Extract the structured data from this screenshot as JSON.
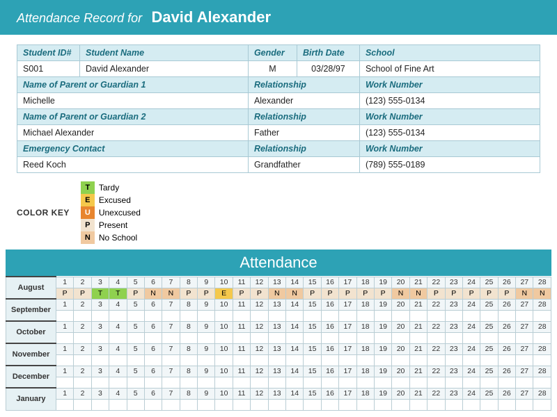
{
  "header": {
    "prefix": "Attendance Record for",
    "student_name": "David Alexander"
  },
  "info": {
    "student_id_h": "Student ID#",
    "student_name_h": "Student Name",
    "gender_h": "Gender",
    "birthdate_h": "Birth Date",
    "school_h": "School",
    "student_id": "S001",
    "student_name": "David Alexander",
    "gender": "M",
    "birthdate": "03/28/97",
    "school": "School of Fine Art",
    "guardian1_h": "Name of Parent or Guardian 1",
    "rel_h": "Relationship",
    "work_h": "Work Number",
    "guardian1_name": "Michelle",
    "guardian1_rel": "Alexander",
    "guardian1_work": "(123) 555-0134",
    "guardian2_h": "Name of Parent or Guardian 2",
    "guardian2_name": "Michael Alexander",
    "guardian2_rel": "Father",
    "guardian2_work": "(123) 555-0134",
    "emergency_h": "Emergency Contact",
    "emergency_name": "Reed Koch",
    "emergency_rel": "Grandfather",
    "emergency_work": "(789) 555-0189"
  },
  "colorkey": {
    "label": "COLOR KEY",
    "items": [
      {
        "code": "T",
        "text": "Tardy",
        "cls": "sw-tardy"
      },
      {
        "code": "E",
        "text": "Excused",
        "cls": "sw-excused"
      },
      {
        "code": "U",
        "text": "Unexcused",
        "cls": "sw-unexcused"
      },
      {
        "code": "P",
        "text": "Present",
        "cls": "sw-present"
      },
      {
        "code": "N",
        "text": "No School",
        "cls": "sw-noschool"
      }
    ]
  },
  "attendance": {
    "title": "Attendance",
    "days": [
      1,
      2,
      3,
      4,
      5,
      6,
      7,
      8,
      9,
      10,
      11,
      12,
      13,
      14,
      15,
      16,
      17,
      18,
      19,
      20,
      21,
      22,
      23,
      24,
      25,
      26,
      27,
      28
    ],
    "months": [
      {
        "name": "August",
        "values": [
          "P",
          "P",
          "T",
          "T",
          "P",
          "N",
          "N",
          "P",
          "P",
          "E",
          "P",
          "P",
          "N",
          "N",
          "P",
          "P",
          "P",
          "P",
          "P",
          "N",
          "N",
          "P",
          "P",
          "P",
          "P",
          "P",
          "N",
          "N"
        ]
      },
      {
        "name": "September",
        "values": [
          "",
          "",
          "",
          "",
          "",
          "",
          "",
          "",
          "",
          "",
          "",
          "",
          "",
          "",
          "",
          "",
          "",
          "",
          "",
          "",
          "",
          "",
          "",
          "",
          "",
          "",
          "",
          ""
        ]
      },
      {
        "name": "October",
        "values": [
          "",
          "",
          "",
          "",
          "",
          "",
          "",
          "",
          "",
          "",
          "",
          "",
          "",
          "",
          "",
          "",
          "",
          "",
          "",
          "",
          "",
          "",
          "",
          "",
          "",
          "",
          "",
          ""
        ]
      },
      {
        "name": "November",
        "values": [
          "",
          "",
          "",
          "",
          "",
          "",
          "",
          "",
          "",
          "",
          "",
          "",
          "",
          "",
          "",
          "",
          "",
          "",
          "",
          "",
          "",
          "",
          "",
          "",
          "",
          "",
          "",
          ""
        ]
      },
      {
        "name": "December",
        "values": [
          "",
          "",
          "",
          "",
          "",
          "",
          "",
          "",
          "",
          "",
          "",
          "",
          "",
          "",
          "",
          "",
          "",
          "",
          "",
          "",
          "",
          "",
          "",
          "",
          "",
          "",
          "",
          ""
        ]
      },
      {
        "name": "January",
        "values": [
          "",
          "",
          "",
          "",
          "",
          "",
          "",
          "",
          "",
          "",
          "",
          "",
          "",
          "",
          "",
          "",
          "",
          "",
          "",
          "",
          "",
          "",
          "",
          "",
          "",
          "",
          "",
          ""
        ]
      }
    ]
  }
}
